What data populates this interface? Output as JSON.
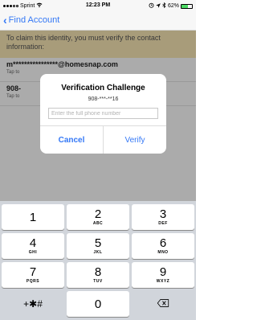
{
  "status_bar": {
    "carrier": "Sprint",
    "time": "12:23 PM",
    "battery": "62%",
    "battery_level": 0.62
  },
  "nav": {
    "back_label": "Find Account"
  },
  "notice": {
    "text": "To claim this identity, you must verify the contact information:"
  },
  "contacts": [
    {
      "value": "m****************@homesnap.com",
      "hint": "Tap to"
    },
    {
      "value": "908-",
      "hint": "Tap to"
    }
  ],
  "dialog": {
    "title": "Verification Challenge",
    "message": "908-***-**16",
    "input_placeholder": "Enter the full phone number",
    "input_value": "",
    "cancel_label": "Cancel",
    "verify_label": "Verify"
  },
  "keypad": {
    "keys": [
      {
        "digit": "1",
        "letters": ""
      },
      {
        "digit": "2",
        "letters": "ABC"
      },
      {
        "digit": "3",
        "letters": "DEF"
      },
      {
        "digit": "4",
        "letters": "GHI"
      },
      {
        "digit": "5",
        "letters": "JKL"
      },
      {
        "digit": "6",
        "letters": "MNO"
      },
      {
        "digit": "7",
        "letters": "PQRS"
      },
      {
        "digit": "8",
        "letters": "TUV"
      },
      {
        "digit": "9",
        "letters": "WXYZ"
      }
    ],
    "symbols_label": "+✱#",
    "zero": "0"
  },
  "colors": {
    "accent": "#3478f6",
    "notice_bg": "#fbe9b7",
    "battery_fill": "#4cd964"
  }
}
